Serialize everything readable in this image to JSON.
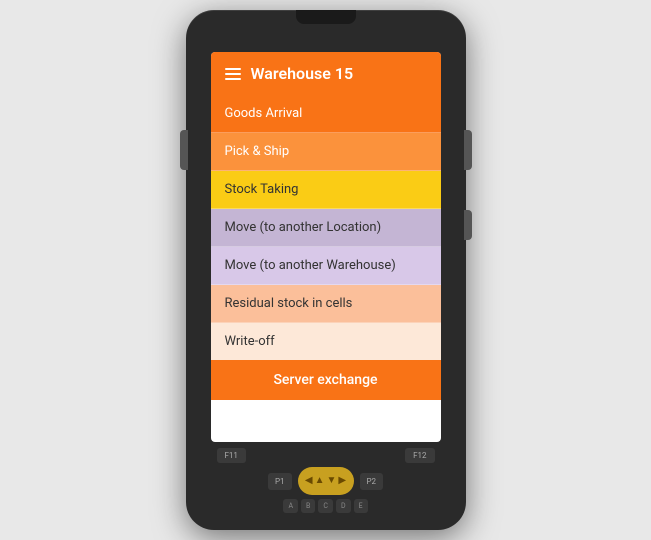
{
  "header": {
    "title": "Warehouse 15",
    "menu_icon": "hamburger-icon"
  },
  "menu_items": [
    {
      "id": "goods-arrival",
      "label": "Goods Arrival",
      "class": "goods-arrival"
    },
    {
      "id": "pick-ship",
      "label": "Pick & Ship",
      "class": "pick-ship"
    },
    {
      "id": "stock-taking",
      "label": "Stock Taking",
      "class": "stock-taking"
    },
    {
      "id": "move-location",
      "label": "Move (to another Location)",
      "class": "move-location"
    },
    {
      "id": "move-warehouse",
      "label": "Move (to another Warehouse)",
      "class": "move-warehouse"
    },
    {
      "id": "residual-stock",
      "label": "Residual stock in cells",
      "class": "residual-stock"
    },
    {
      "id": "write-off",
      "label": "Write-off",
      "class": "write-off"
    }
  ],
  "server_exchange_label": "Server exchange",
  "keypad": {
    "f11": "F11",
    "f12": "F12",
    "p1": "P1",
    "p2": "P2",
    "letters": [
      "A",
      "B",
      "C",
      "D",
      "E"
    ]
  }
}
